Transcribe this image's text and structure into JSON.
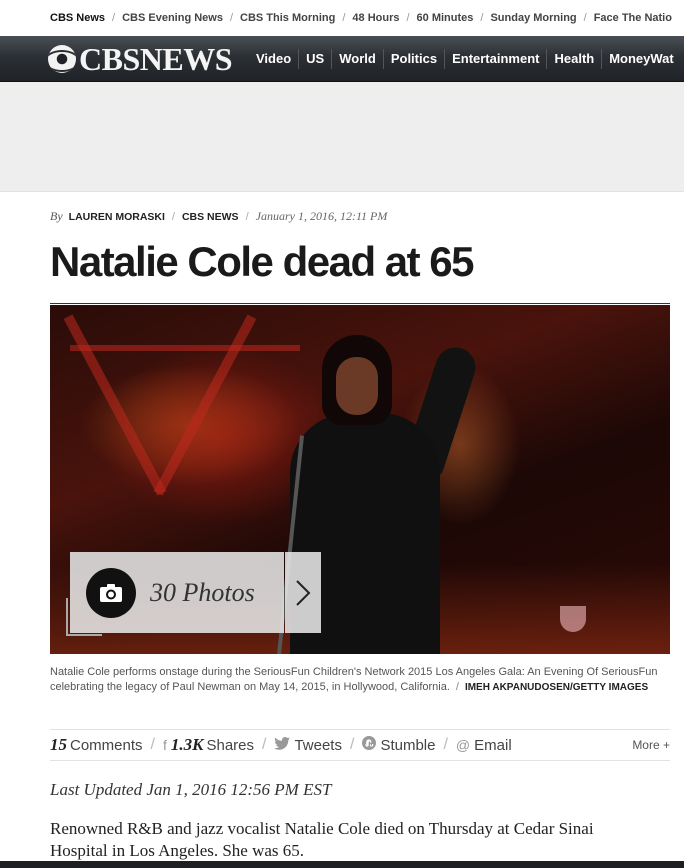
{
  "network_bar": {
    "items": [
      "CBS News",
      "CBS Evening News",
      "CBS This Morning",
      "48 Hours",
      "60 Minutes",
      "Sunday Morning",
      "Face The Natio"
    ]
  },
  "main_nav": {
    "logo_text": "CBSNEWS",
    "items": [
      "Video",
      "US",
      "World",
      "Politics",
      "Entertainment",
      "Health",
      "MoneyWat"
    ]
  },
  "article": {
    "by": "By",
    "author": "LAUREN MORASKI",
    "source": "CBS NEWS",
    "date": "January 1, 2016, 12:11 PM",
    "headline": "Natalie Cole dead at 65",
    "gallery": {
      "label": "30 Photos"
    },
    "caption": "Natalie Cole performs onstage during the SeriousFun Children's Network 2015 Los Angeles Gala: An Evening Of SeriousFun celebrating the legacy of Paul Newman on May 14, 2015, in Hollywood, California.",
    "caption_credit": "IMEH AKPANUDOSEN/GETTY IMAGES",
    "share": {
      "comments_count": "15",
      "comments_label": "Comments",
      "shares_count": "1.3K",
      "shares_label": "Shares",
      "tweets_label": "Tweets",
      "stumble_label": "Stumble",
      "email_label": "Email",
      "more_label": "More +"
    },
    "last_updated": "Last Updated Jan 1, 2016 12:56 PM EST",
    "body": "Renowned R&B and jazz vocalist Natalie Cole died on Thursday at Cedar Sinai Hospital in Los Angeles. She was 65."
  },
  "colors": {
    "nav_bg": "#2c3035",
    "ad_bg": "#eeeeee",
    "text": "#222222"
  }
}
